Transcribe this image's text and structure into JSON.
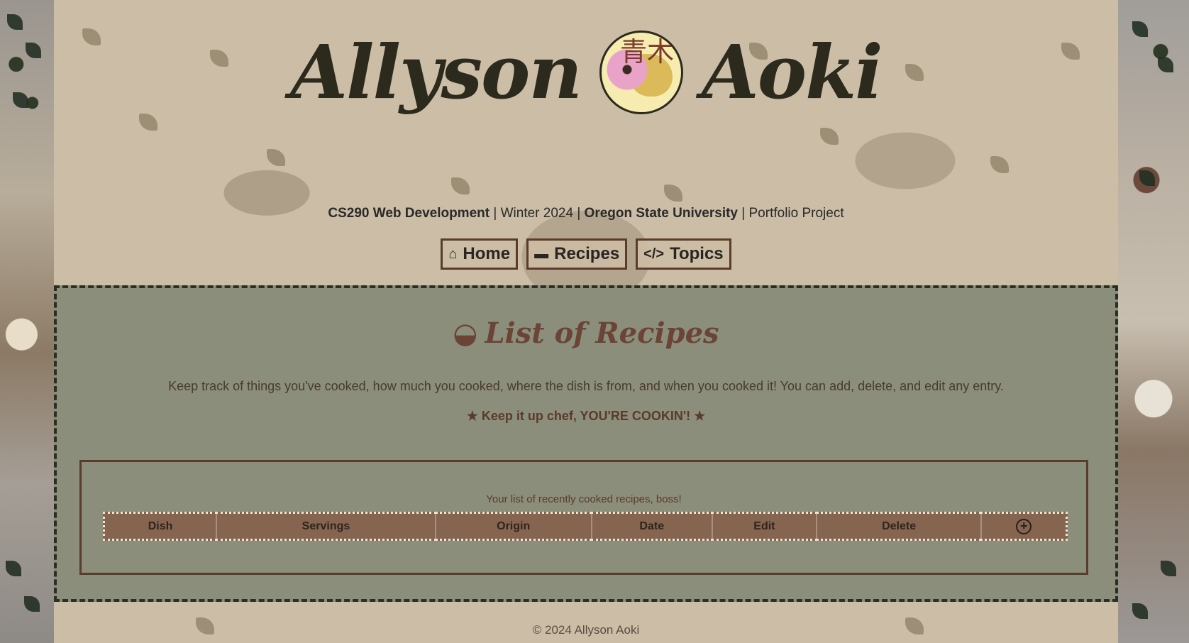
{
  "site": {
    "first_name": "Allyson",
    "last_name": "Aoki",
    "logo_kanji": "青木"
  },
  "tagline": {
    "course": "CS290 Web Development",
    "sep1": " | ",
    "term": "Winter 2024",
    "sep2": " | ",
    "school": "Oregon State University",
    "sep3": " | ",
    "project": "Portfolio Project"
  },
  "nav": [
    {
      "label": "Home",
      "icon": "home-icon"
    },
    {
      "label": "Recipes",
      "icon": "pot-icon"
    },
    {
      "label": "Topics",
      "icon": "code-icon"
    }
  ],
  "main": {
    "title": "List of Recipes",
    "intro": "Keep track of things you've cooked, how much you cooked, where the dish is from, and when you cooked it! You can add, delete, and edit any entry.",
    "cheer": "Keep it up chef, YOU'RE COOKIN'!",
    "caption": "Your list of recently cooked recipes, boss!",
    "columns": [
      "Dish",
      "Servings",
      "Origin",
      "Date",
      "Edit",
      "Delete"
    ],
    "add_symbol": "+"
  },
  "footer": {
    "text": "© 2024 Allyson Aoki"
  },
  "colors": {
    "main_bg": "#8a8e7a",
    "accent_brown": "#5a3b2c",
    "table_header": "#856550"
  }
}
